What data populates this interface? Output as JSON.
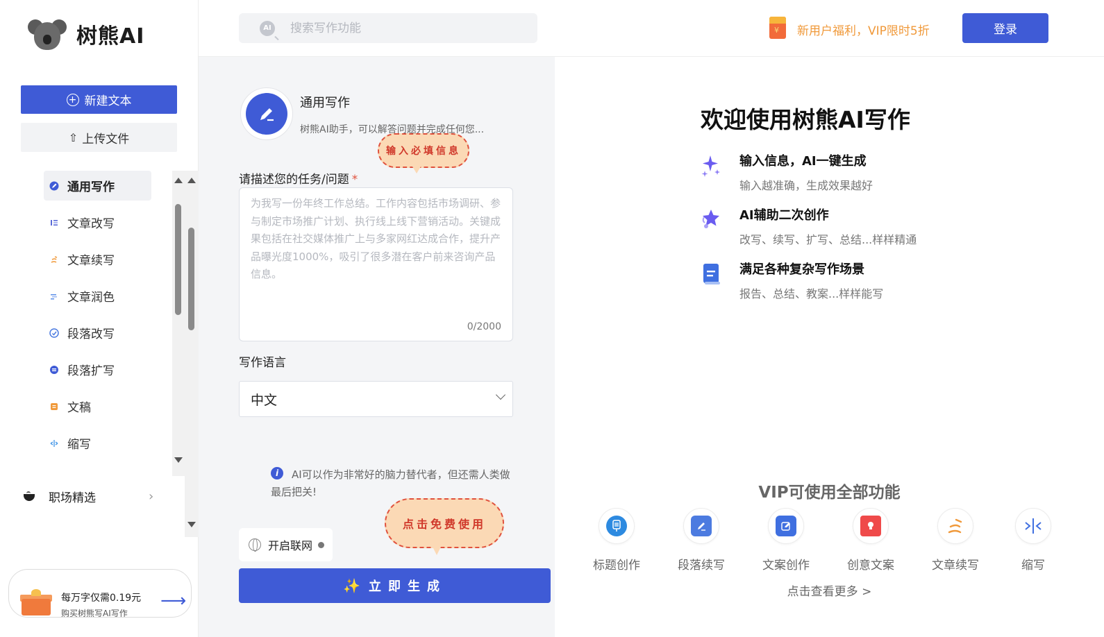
{
  "brand": {
    "name": "树熊AI"
  },
  "sidebar": {
    "new_text_label": "新建文本",
    "upload_label": "上传文件",
    "items": [
      {
        "label": "通用写作",
        "icon": "pen-circle-icon",
        "color": "#3f5bd6",
        "active": true
      },
      {
        "label": "文章改写",
        "icon": "list-icon",
        "color": "#5a6ad8",
        "active": false
      },
      {
        "label": "文章续写",
        "icon": "scribble-icon",
        "color": "#f0993a",
        "active": false
      },
      {
        "label": "文章润色",
        "icon": "lines-icon",
        "color": "#5a8ee8",
        "active": false
      },
      {
        "label": "段落改写",
        "icon": "refresh-icon",
        "color": "#4c7be0",
        "active": false
      },
      {
        "label": "段落扩写",
        "icon": "expand-icon",
        "color": "#3f5bd6",
        "active": false
      },
      {
        "label": "文稿",
        "icon": "doc-square-icon",
        "color": "#f0993a",
        "active": false
      },
      {
        "label": "缩写",
        "icon": "compress-icon",
        "color": "#4c9be8",
        "active": false
      }
    ],
    "career_label": "职场精选",
    "promo": {
      "line1": "每万字仅需0.19元",
      "line2": "购买树熊写AI写作"
    }
  },
  "header": {
    "search_placeholder": "搜索写作功能",
    "promo_text": "新用户福利，VIP限时5折",
    "login_label": "登录"
  },
  "form": {
    "tool_title": "通用写作",
    "tool_desc": "树熊AI助手，可以解答问题并完成任何您...",
    "bubble_required": "输入必填信息",
    "task_label": "请描述您的任务/问题",
    "required_mark": "*",
    "task_placeholder": "为我写一份年终工作总结。工作内容包括市场调研、参与制定市场推广计划、执行线上线下营销活动。关键成果包括在社交媒体推广上与多家网红达成合作，提升产品曝光度1000%，吸引了很多潜在客户前来咨询产品信息。",
    "task_count": "0/2000",
    "language_label": "写作语言",
    "language_value": "中文",
    "tip_text": "AI可以作为非常好的脑力替代者，但还需人类做最后把关!",
    "bubble_free": "点击免费使用",
    "net_label": "开启联网",
    "generate_label": "立即生成"
  },
  "right": {
    "welcome_title": "欢迎使用树熊AI写作",
    "features": [
      {
        "title": "输入信息，AI一键生成",
        "desc": "输入越准确，生成效果越好",
        "icon": "sparkle-icon"
      },
      {
        "title": "AI辅助二次创作",
        "desc": "改写、续写、扩写、总结...样样精通",
        "icon": "star-assist-icon"
      },
      {
        "title": "满足各种复杂写作场景",
        "desc": "报告、总结、教案...样样能写",
        "icon": "document-icon"
      }
    ],
    "vip_title": "VIP可使用全部功能",
    "vip_items": [
      {
        "label": "标题创作",
        "icon": "pencil-circle-icon",
        "color": "#2d8ae0"
      },
      {
        "label": "段落续写",
        "icon": "edit-pen-icon",
        "color": "#4c7be0"
      },
      {
        "label": "文案创作",
        "icon": "edit-square-icon",
        "color": "#3f6fe0"
      },
      {
        "label": "创意文案",
        "icon": "lightbulb-icon",
        "color": "#ef4a4a"
      },
      {
        "label": "文章续写",
        "icon": "scribble-icon",
        "color": "#f0993a"
      },
      {
        "label": "缩写",
        "icon": "compress-icon",
        "color": "#3f6fe0"
      }
    ],
    "see_more": "点击查看更多 >"
  }
}
